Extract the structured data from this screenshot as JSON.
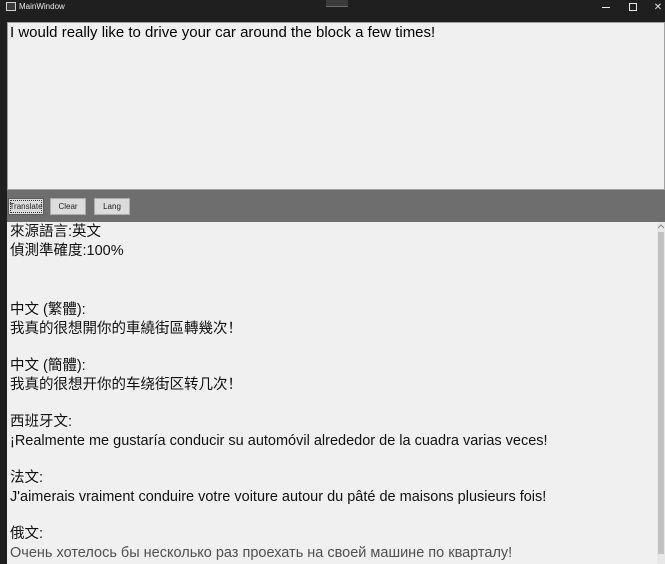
{
  "window": {
    "title": "MainWindow",
    "icons": {
      "app": "app-window-icon",
      "minimize": "minimize-icon",
      "maximize": "maximize-icon",
      "close": "close-icon"
    },
    "close_glyph": "✕"
  },
  "input": {
    "value": "I would really like to drive your car around the block a few times!"
  },
  "toolbar": {
    "translate_label": "Translate",
    "clear_label": "Clear",
    "lang_label": "Lang"
  },
  "output": {
    "source_language": "來源語言:英文",
    "confidence": "偵測準確度:100%",
    "translations": [
      {
        "language": "中文 (繁體):",
        "text": "我真的很想開你的車繞街區轉幾次！"
      },
      {
        "language": "中文 (簡體):",
        "text": "我真的很想开你的车绕街区转几次！"
      },
      {
        "language": "西班牙文:",
        "text": "¡Realmente me gustaría conducir su automóvil alrededor de la cuadra varias veces!"
      },
      {
        "language": "法文:",
        "text": "J'aimerais vraiment conduire votre voiture autour du pâté de maisons plusieurs fois!"
      },
      {
        "language": "俄文:",
        "text": "Очень хотелось бы несколько раз проехать на своей машине по кварталу!"
      }
    ]
  },
  "colors": {
    "titlebar": "#1f1f1f",
    "panel": "#f0f0f0",
    "toolbar": "#6e6e6e"
  }
}
